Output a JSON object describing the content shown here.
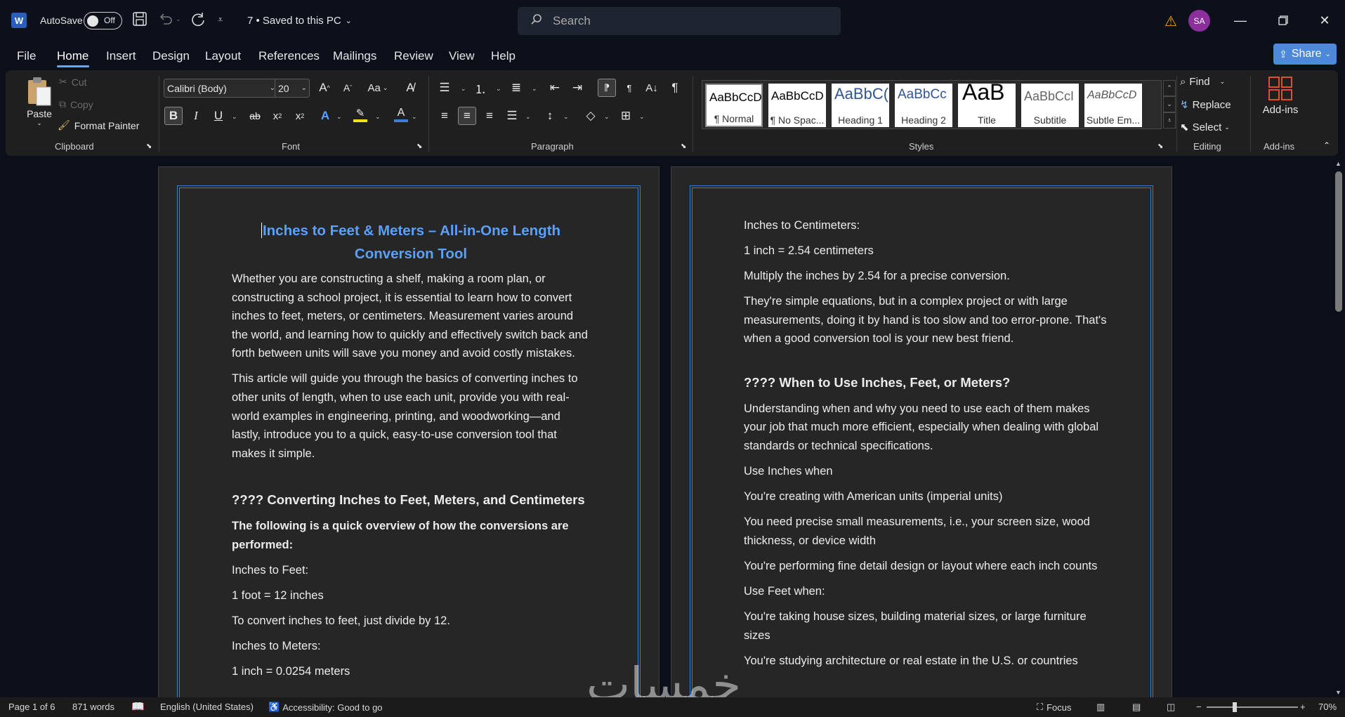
{
  "titlebar": {
    "app_icon": "W",
    "autosave_label": "AutoSave",
    "autosave_state": "Off",
    "doc_title": "7 • Saved to this PC",
    "search_placeholder": "Search",
    "avatar_initials": "SA",
    "icons": [
      "save-icon",
      "undo-icon",
      "redo-icon",
      "customize-icon",
      "warning-icon",
      "minimize-icon",
      "restore-icon",
      "close-icon"
    ]
  },
  "menu": {
    "tabs": [
      "File",
      "Home",
      "Insert",
      "Design",
      "Layout",
      "References",
      "Mailings",
      "Review",
      "View",
      "Help"
    ],
    "active_tab": "Home",
    "share_label": "Share"
  },
  "ribbon": {
    "clipboard": {
      "paste": "Paste",
      "cut": "Cut",
      "copy": "Copy",
      "format_painter": "Format Painter",
      "label": "Clipboard"
    },
    "font": {
      "font_name": "Calibri (Body)",
      "font_size": "20",
      "label": "Font"
    },
    "paragraph": {
      "label": "Paragraph"
    },
    "styles": {
      "label": "Styles",
      "items": [
        {
          "sample": "AaBbCcD",
          "name": "¶ Normal"
        },
        {
          "sample": "AaBbCcD",
          "name": "¶ No Spac..."
        },
        {
          "sample": "AaBbC(",
          "name": "Heading 1"
        },
        {
          "sample": "AaBbCc",
          "name": "Heading 2"
        },
        {
          "sample": "AaB",
          "name": "Title"
        },
        {
          "sample": "AaBbCcI",
          "name": "Subtitle"
        },
        {
          "sample": "AaBbCcD",
          "name": "Subtle Em..."
        }
      ]
    },
    "editing": {
      "find": "Find",
      "replace": "Replace",
      "select": "Select",
      "label": "Editing"
    },
    "addins": {
      "button": "Add-ins",
      "label": "Add-ins"
    },
    "colors": {
      "highlight": "#f3e21b",
      "font_color": "#d13438",
      "accent": "#6aa6f0"
    }
  },
  "document": {
    "page1": {
      "title": "Inches to Feet & Meters – All-in-One Length Conversion Tool",
      "p1": "Whether you are constructing a shelf, making a room plan, or constructing a school project, it is essential to learn how to convert inches to feet, meters, or centimeters. Measurement varies around the world, and learning how to quickly and effectively switch back and forth between units will save you money and avoid costly mistakes.",
      "p2": "This article will guide you through the basics of converting inches to other units of length, when to use each unit, provide you with real-world examples in engineering, printing, and woodworking—and lastly, introduce you to a quick, easy-to-use conversion tool that makes it simple.",
      "h2": "???? Converting Inches to Feet, Meters, and Centimeters",
      "bold_intro": "The following is a quick overview of how the conversions are performed:",
      "l1": "Inches to Feet:",
      "l2": "1 foot = 12 inches",
      "l3": "To convert inches to feet, just divide by 12.",
      "l4": "Inches to Meters:",
      "l5": "1 inch = 0.0254 meters"
    },
    "page2": {
      "l1": "Inches to Centimeters:",
      "l2": "1 inch = 2.54 centimeters",
      "l3": "Multiply the inches by 2.54 for a precise conversion.",
      "p1": "They're simple equations, but in a complex project or with large measurements, doing it by hand is too slow and too error-prone. That's when a good conversion tool is your new best friend.",
      "h2": "???? When to Use Inches, Feet, or Meters?",
      "p2": "Understanding when and why you need to use each of them makes your job that much more efficient, especially when dealing with global standards or technical specifications.",
      "l4": "Use Inches when",
      "l5": "You're creating with American units (imperial units)",
      "l6": "You need precise small measurements, i.e., your screen size, wood thickness, or device width",
      "l7": "You're performing fine detail design or layout where each inch counts",
      "l8": "Use Feet when:",
      "l9": "You're taking house sizes, building material sizes, or large furniture sizes",
      "l10": "You're studying architecture or real estate in the U.S. or countries"
    }
  },
  "watermark": "خمسات",
  "statusbar": {
    "page": "Page 1 of 6",
    "words": "871 words",
    "language": "English (United States)",
    "accessibility": "Accessibility: Good to go",
    "focus": "Focus",
    "zoom": "70%"
  }
}
